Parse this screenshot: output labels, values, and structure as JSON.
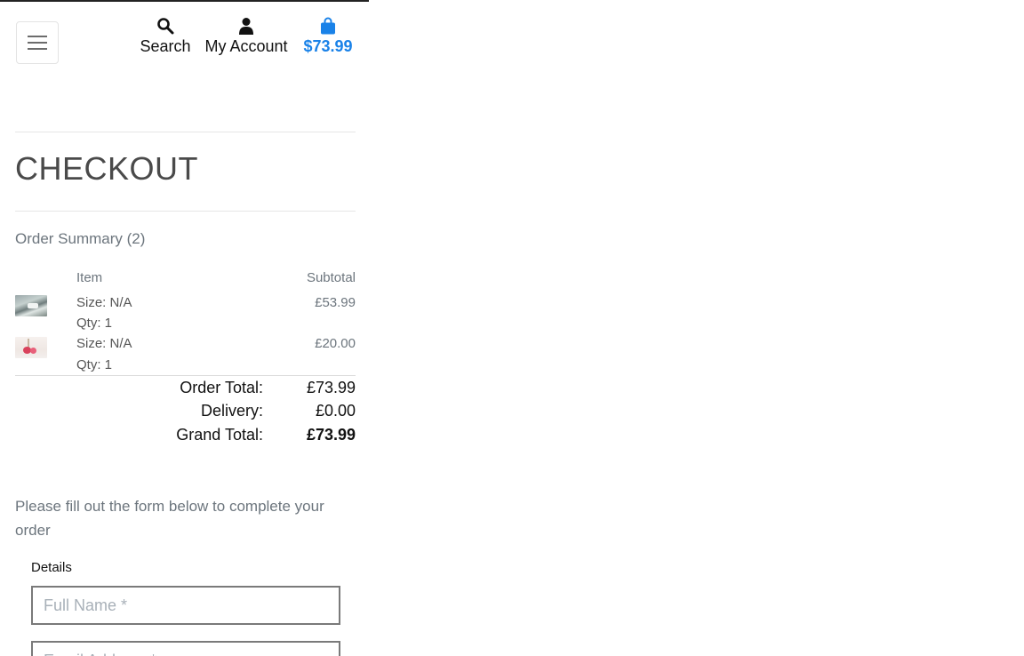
{
  "header": {
    "menu_icon": "hamburger-icon",
    "search": {
      "label": "Search",
      "icon": "search-icon"
    },
    "account": {
      "label": "My Account",
      "icon": "user-icon"
    },
    "bag": {
      "label": "$73.99",
      "icon": "shopping-bag-icon",
      "color": "#1a82e8"
    }
  },
  "page": {
    "title": "CHECKOUT"
  },
  "summary": {
    "title": "Order Summary (2)",
    "col_item": "Item",
    "col_subtotal": "Subtotal",
    "items": [
      {
        "size": "Size: N/A",
        "qty": "Qty: 1",
        "price": "£53.99"
      },
      {
        "size": "Size: N/A",
        "qty": "Qty: 1",
        "price": "£20.00"
      }
    ],
    "order_total_label": "Order Total:",
    "order_total_value": "£73.99",
    "delivery_label": "Delivery:",
    "delivery_value": "£0.00",
    "grand_total_label": "Grand Total:",
    "grand_total_value": "£73.99"
  },
  "form": {
    "instructions": "Please fill out the form below to complete your order",
    "details_legend": "Details",
    "full_name_placeholder": "Full Name *",
    "email_placeholder": "Email Address *"
  }
}
